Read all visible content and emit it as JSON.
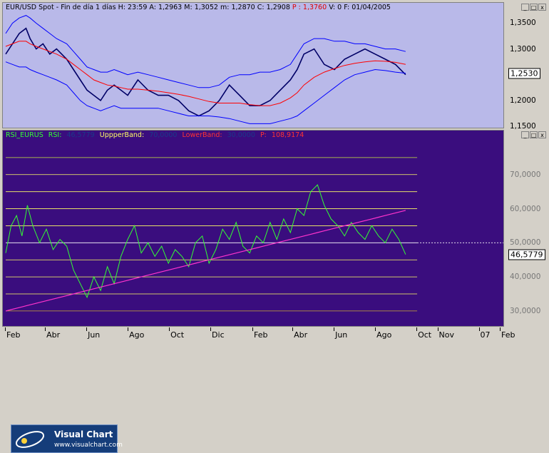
{
  "price_header": {
    "symbol": "EUR/USD Spot",
    "period": "Fin de día 1 días",
    "h_label": "H:",
    "h_value": "23:59",
    "a_label": "A:",
    "a_value": "1,2963",
    "m_label": "M:",
    "m_value": "1,3052",
    "mi_label": "m:",
    "mi_value": "1,2870",
    "c_label": "C:",
    "c_value": "1,2908",
    "p_label": "P :",
    "p_value": "1,3760",
    "v_label": "V:",
    "v_value": "0",
    "f_label": "F:",
    "f_value": "01/04/2005"
  },
  "rsi_header": {
    "name": "RSI_EURUS",
    "rsi_label": "RSI:",
    "rsi_value": "46,5779",
    "upper_label": "UppperBand:",
    "upper_value": "70,0000",
    "lower_label": "LowerBand:",
    "lower_value": "30,0000",
    "p_label": "P:",
    "p_value": "108,9174"
  },
  "window_buttons": [
    "_",
    "□",
    "x"
  ],
  "price_axis": {
    "ticks": [
      {
        "label": "1,3500",
        "value": 1.35
      },
      {
        "label": "1,3000",
        "value": 1.3
      },
      {
        "label": "1,2500",
        "value": 1.25
      },
      {
        "label": "1,2000",
        "value": 1.2
      },
      {
        "label": "1,1500",
        "value": 1.15
      }
    ],
    "last_label": "1,2530",
    "last_value": 1.253,
    "range": [
      1.15,
      1.37
    ]
  },
  "rsi_axis": {
    "ticks": [
      {
        "label": "70,0000",
        "value": 70
      },
      {
        "label": "60,0000",
        "value": 60
      },
      {
        "label": "50,0000",
        "value": 50
      },
      {
        "label": "40,0000",
        "value": 40
      },
      {
        "label": "30,0000",
        "value": 30
      }
    ],
    "last_label": "46,5779",
    "last_value": 46.5779,
    "range": [
      26,
      80
    ]
  },
  "x_axis": {
    "ticks": [
      "Feb",
      "Abr",
      "Jun",
      "Ago",
      "Oct",
      "Dic",
      "Feb",
      "Abr",
      "Jun",
      "Ago",
      "Oct",
      "Nov",
      "07",
      "Feb"
    ],
    "tick_days": [
      0,
      59,
      120,
      181,
      242,
      303,
      365,
      424,
      485,
      546,
      607,
      638,
      699,
      730
    ]
  },
  "logo": {
    "name": "Visual Chart",
    "url": "www.visualchart.com"
  },
  "colors": {
    "price_bg": "#b9b9e9",
    "rsi_bg": "#3a0d7e",
    "price_line": "#000066",
    "ma_line": "#ff0000",
    "bands": "#0000ff",
    "rsi_line": "#33ff33",
    "trendline": "#ff33cc",
    "upper_band_line": "#ffff66"
  },
  "chart_data": [
    {
      "type": "line",
      "name": "price",
      "x_unit": "days since Feb (chart start)",
      "x": [
        0,
        10,
        20,
        30,
        36,
        45,
        55,
        65,
        75,
        90,
        100,
        110,
        120,
        130,
        140,
        150,
        160,
        170,
        180,
        195,
        210,
        225,
        240,
        255,
        270,
        285,
        300,
        315,
        330,
        345,
        360,
        375,
        390,
        405,
        420,
        430,
        440,
        455,
        470,
        485,
        500,
        515,
        530,
        545,
        560,
        575,
        590
      ],
      "series": [
        {
          "name": "EUR/USD",
          "values": [
            1.29,
            1.31,
            1.33,
            1.34,
            1.32,
            1.3,
            1.31,
            1.29,
            1.3,
            1.28,
            1.26,
            1.24,
            1.22,
            1.21,
            1.2,
            1.22,
            1.23,
            1.22,
            1.21,
            1.24,
            1.22,
            1.21,
            1.21,
            1.2,
            1.18,
            1.17,
            1.18,
            1.2,
            1.23,
            1.21,
            1.19,
            1.19,
            1.2,
            1.22,
            1.24,
            1.26,
            1.29,
            1.3,
            1.27,
            1.26,
            1.28,
            1.29,
            1.3,
            1.29,
            1.28,
            1.27,
            1.25
          ]
        },
        {
          "name": "moving-average",
          "values": [
            1.305,
            1.31,
            1.315,
            1.315,
            1.31,
            1.305,
            1.3,
            1.295,
            1.29,
            1.28,
            1.27,
            1.26,
            1.25,
            1.24,
            1.235,
            1.23,
            1.228,
            1.225,
            1.222,
            1.222,
            1.22,
            1.218,
            1.215,
            1.212,
            1.208,
            1.203,
            1.198,
            1.195,
            1.195,
            1.195,
            1.192,
            1.19,
            1.19,
            1.195,
            1.205,
            1.215,
            1.23,
            1.245,
            1.255,
            1.262,
            1.268,
            1.272,
            1.275,
            1.277,
            1.276,
            1.274,
            1.27
          ]
        },
        {
          "name": "upper-band",
          "values": [
            1.33,
            1.35,
            1.36,
            1.365,
            1.36,
            1.35,
            1.34,
            1.33,
            1.32,
            1.31,
            1.295,
            1.28,
            1.265,
            1.26,
            1.255,
            1.255,
            1.26,
            1.255,
            1.25,
            1.255,
            1.25,
            1.245,
            1.24,
            1.235,
            1.23,
            1.225,
            1.225,
            1.23,
            1.245,
            1.25,
            1.25,
            1.255,
            1.255,
            1.26,
            1.27,
            1.29,
            1.31,
            1.32,
            1.32,
            1.315,
            1.315,
            1.31,
            1.31,
            1.305,
            1.3,
            1.3,
            1.295
          ]
        },
        {
          "name": "lower-band",
          "values": [
            1.275,
            1.27,
            1.265,
            1.265,
            1.26,
            1.255,
            1.25,
            1.245,
            1.24,
            1.23,
            1.215,
            1.2,
            1.19,
            1.185,
            1.18,
            1.185,
            1.19,
            1.185,
            1.185,
            1.185,
            1.185,
            1.185,
            1.18,
            1.175,
            1.17,
            1.17,
            1.17,
            1.168,
            1.165,
            1.16,
            1.155,
            1.155,
            1.155,
            1.16,
            1.165,
            1.17,
            1.18,
            1.195,
            1.21,
            1.225,
            1.24,
            1.25,
            1.255,
            1.26,
            1.258,
            1.255,
            1.253
          ]
        }
      ],
      "ylim": [
        1.15,
        1.37
      ]
    },
    {
      "type": "line",
      "name": "rsi",
      "x_unit": "days since Feb (chart start)",
      "x": [
        0,
        8,
        16,
        24,
        32,
        40,
        50,
        60,
        70,
        80,
        90,
        100,
        110,
        120,
        130,
        140,
        150,
        160,
        170,
        180,
        190,
        200,
        210,
        220,
        230,
        240,
        250,
        260,
        270,
        280,
        290,
        300,
        310,
        320,
        330,
        340,
        350,
        360,
        370,
        380,
        390,
        400,
        410,
        420,
        430,
        440,
        450,
        460,
        470,
        480,
        490,
        500,
        510,
        520,
        530,
        540,
        550,
        560,
        570,
        580,
        590
      ],
      "series": [
        {
          "name": "RSI_EURUS",
          "values": [
            47,
            55,
            58,
            52,
            61,
            55,
            50,
            54,
            48,
            51,
            49,
            42,
            38,
            34,
            40,
            36,
            43,
            38,
            46,
            51,
            55,
            47,
            50,
            46,
            49,
            44,
            48,
            46,
            43,
            50,
            52,
            44,
            48,
            54,
            51,
            56,
            49,
            47,
            52,
            50,
            56,
            51,
            57,
            53,
            60,
            58,
            65,
            67,
            61,
            57,
            55,
            52,
            56,
            53,
            51,
            55,
            52,
            50,
            54,
            51,
            46.58
          ]
        },
        {
          "name": "trendline",
          "values": [
            30,
            30.4,
            30.8,
            31.2,
            31.6,
            32,
            32.5,
            33,
            33.5,
            34,
            34.5,
            35,
            35.5,
            36,
            36.5,
            37,
            37.5,
            38,
            38.5,
            39,
            39.5,
            40,
            40.5,
            41,
            41.5,
            42,
            42.5,
            43,
            43.5,
            44,
            44.5,
            45,
            45.5,
            46,
            46.5,
            47,
            47.5,
            48,
            48.5,
            49,
            49.5,
            50,
            50.5,
            51,
            51.5,
            52,
            52.5,
            53,
            53.5,
            54,
            54.5,
            55,
            55.5,
            56,
            56.5,
            57,
            57.5,
            58,
            58.5,
            59,
            59.5
          ]
        }
      ],
      "bands": {
        "upper": 70,
        "lower": 30
      },
      "ylim": [
        26,
        80
      ]
    }
  ]
}
